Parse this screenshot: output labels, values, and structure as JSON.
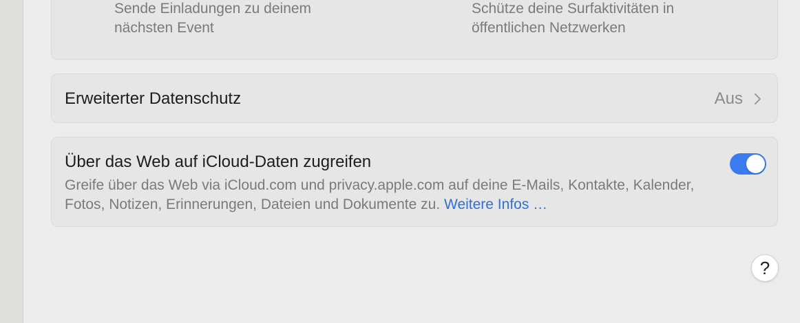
{
  "top_card": {
    "left_subtitle_line1": "Sende Einladungen zu deinem",
    "left_subtitle_line2": "nächsten Event",
    "right_subtitle_line1": "Schütze deine Surfaktivitäten in",
    "right_subtitle_line2": "öffentlichen Netzwerken"
  },
  "advanced_data_protection": {
    "title": "Erweiterter Datenschutz",
    "value": "Aus",
    "chevron_icon": "chevron-right-icon"
  },
  "web_access": {
    "title": "Über das Web auf iCloud-Daten zugreifen",
    "description": "Greife über das Web via iCloud.com und privacy.apple.com auf deine E-Mails, Kontakte, Kalender, Fotos, Notizen, Erinnerungen, Dateien und Dokumente zu.",
    "link_label": "Weitere Infos …",
    "toggle_on": true
  },
  "help_button": {
    "label": "?"
  },
  "colors": {
    "accent": "#3b7bf0",
    "link": "#2f6fd9",
    "card_background": "#e6e6e6",
    "window_background": "#ececec"
  }
}
